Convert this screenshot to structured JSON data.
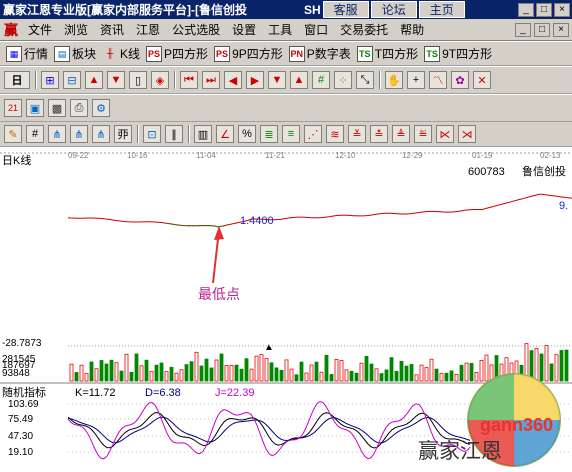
{
  "titlebar": {
    "title": "赢家江恩专业版[赢家内部服务平台]-[鲁信创投",
    "sh": "SH",
    "tabs": [
      "客服",
      "论坛",
      "主页"
    ],
    "min": "_",
    "max": "□",
    "close": "×"
  },
  "menubar": {
    "logo": "赢",
    "items": [
      "文件",
      "浏览",
      "资讯",
      "江恩",
      "公式选股",
      "设置",
      "工具",
      "窗口",
      "交易委托",
      "帮助"
    ]
  },
  "toolbar1": {
    "items": [
      {
        "icon": "grid",
        "label": "行情"
      },
      {
        "icon": "blocks",
        "label": "板块"
      },
      {
        "icon": "candle",
        "label": "K线"
      },
      {
        "icon": "PS",
        "label": "P四方形"
      },
      {
        "icon": "PS",
        "label": "9P四方形"
      },
      {
        "icon": "PN",
        "label": "P数字表"
      },
      {
        "icon": "TS",
        "label": "T四方形"
      },
      {
        "icon": "TS",
        "label": "9T四方形"
      }
    ]
  },
  "toolbar2": {
    "period": "日",
    "icons": [
      "split",
      "nav",
      "prev",
      "next",
      "lock",
      "first",
      "last",
      "left",
      "right",
      "down",
      "up",
      "hash",
      "dots",
      "move",
      "cross",
      "zoom",
      "chart",
      "x"
    ]
  },
  "toolbar3": {
    "icons": [
      "calendar",
      "bar",
      "save",
      "print",
      "settings",
      "extra"
    ]
  },
  "toolbar4": {
    "icons": [
      "pen",
      "grid1",
      "fan1",
      "fan2",
      "fan3",
      "fan4",
      "box",
      "bars",
      "pct",
      "percent",
      "g1",
      "g2",
      "g3",
      "g4",
      "g5",
      "g6",
      "g7",
      "g8",
      "g9",
      "g10"
    ]
  },
  "chart_data": {
    "type": "line",
    "period_label": "日K线",
    "stock_code": "600783",
    "stock_name": "鲁信创投",
    "dates": [
      "09-22",
      "10-16",
      "11-04",
      "11-21",
      "12-10",
      "12-29",
      "01-19",
      "02-13"
    ],
    "annotation_value": "1.4400",
    "annotation_text": "最低点",
    "right_edge_value": "9.",
    "volume_labels": [
      "-28.7873",
      "281545",
      "187697",
      "93848"
    ],
    "indicator_name": "随机指标",
    "k_label": "K=11.72",
    "d_label": "D=6.38",
    "j_label": "J=22.39",
    "indicator_ticks": [
      "103.69",
      "75.49",
      "47.30",
      "19.10"
    ],
    "watermark": "赢家江恩",
    "watermark_site": "gann360"
  },
  "colors": {
    "title_bg": "#0a246a",
    "up": "#e00000",
    "down": "#008000",
    "k": "#000000",
    "d": "#000080",
    "j": "#cc00cc",
    "arrow": "#e53030",
    "annotation": "#2020c0"
  }
}
